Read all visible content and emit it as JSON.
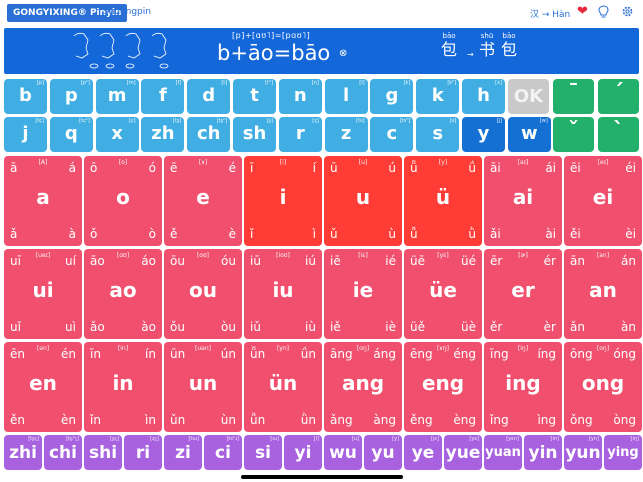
{
  "app": {
    "title": "GONGYIXING® Pinyin",
    "mode": "Shuangpin",
    "lang": "汉 → Hàn"
  },
  "banner": {
    "ipa": "[p]+[ɑʊ˥]=[pɑʊ˥]",
    "formula": "b+āo=bāo",
    "ex1": {
      "py": "bāo",
      "hz": "包"
    },
    "ex2": {
      "py": "shū",
      "hz": "书"
    },
    "ex3": {
      "py": "bāo",
      "hz": "包"
    },
    "arrow": "→"
  },
  "row1": [
    {
      "t": "b",
      "ip": "[p]"
    },
    {
      "t": "p",
      "ip": "[pʰ]"
    },
    {
      "t": "m",
      "ip": "[m]"
    },
    {
      "t": "f",
      "ip": "[f]"
    },
    {
      "t": "d",
      "ip": "[t]"
    },
    {
      "t": "t",
      "ip": "[tʰ]"
    },
    {
      "t": "n",
      "ip": "[n]"
    },
    {
      "t": "l",
      "ip": "[l]"
    },
    {
      "t": "g",
      "ip": "[k]"
    },
    {
      "t": "k",
      "ip": "[kʰ]"
    },
    {
      "t": "h",
      "ip": "[x]"
    }
  ],
  "row1_ok": "OK",
  "row2": [
    {
      "t": "j",
      "ip": "[tɕ]"
    },
    {
      "t": "q",
      "ip": "[tɕʰ]"
    },
    {
      "t": "x",
      "ip": "[ɕ]"
    },
    {
      "t": "zh",
      "ip": "[tʂ]"
    },
    {
      "t": "ch",
      "ip": "[tʂʰ]"
    },
    {
      "t": "sh",
      "ip": "[ʂ]"
    },
    {
      "t": "r",
      "ip": "[ʐ]"
    },
    {
      "t": "z",
      "ip": "[ts]"
    },
    {
      "t": "c",
      "ip": "[tsʰ]"
    },
    {
      "t": "s",
      "ip": "[s]"
    },
    {
      "t": "y",
      "ip": "[j]"
    },
    {
      "t": "w",
      "ip": "[w]"
    }
  ],
  "tones": [
    "¯",
    "´",
    "ˇ",
    "`"
  ],
  "vowels": [
    [
      {
        "m": "a",
        "c": [
          "ā",
          "á",
          "ǎ",
          "à"
        ],
        "ip": "[A]"
      },
      {
        "m": "o",
        "c": [
          "ō",
          "ó",
          "ǒ",
          "ò"
        ],
        "ip": "[o]"
      },
      {
        "m": "e",
        "c": [
          "ē",
          "é",
          "ě",
          "è"
        ],
        "ip": "[ɤ]"
      },
      {
        "m": "i",
        "c": [
          "ī",
          "í",
          "ǐ",
          "ì"
        ],
        "ip": "[i]"
      },
      {
        "m": "u",
        "c": [
          "ū",
          "ú",
          "ǔ",
          "ù"
        ],
        "ip": "[u]"
      },
      {
        "m": "ü",
        "c": [
          "ǖ",
          "ǘ",
          "ǚ",
          "ǜ"
        ],
        "ip": "[y]"
      },
      {
        "m": "ai",
        "c": [
          "āi",
          "ái",
          "ǎi",
          "ài"
        ],
        "ip": "[aɪ]"
      },
      {
        "m": "ei",
        "c": [
          "ēi",
          "éi",
          "ěi",
          "èi"
        ],
        "ip": "[eɪ]"
      }
    ],
    [
      {
        "m": "ui",
        "c": [
          "uī",
          "uí",
          "uǐ",
          "uì"
        ],
        "ip": "[ueɪ]"
      },
      {
        "m": "ao",
        "c": [
          "āo",
          "áo",
          "ǎo",
          "ào"
        ],
        "ip": "[ɑʊ]"
      },
      {
        "m": "ou",
        "c": [
          "ōu",
          "óu",
          "ǒu",
          "òu"
        ],
        "ip": "[oʊ]"
      },
      {
        "m": "iu",
        "c": [
          "iū",
          "iú",
          "iǔ",
          "iù"
        ],
        "ip": "[ioʊ]"
      },
      {
        "m": "ie",
        "c": [
          "iē",
          "ié",
          "iě",
          "iè"
        ],
        "ip": "[iɛ]"
      },
      {
        "m": "üe",
        "c": [
          "üē",
          "üé",
          "üě",
          "üè"
        ],
        "ip": "[yɛ]"
      },
      {
        "m": "er",
        "c": [
          "ēr",
          "ér",
          "ěr",
          "èr"
        ],
        "ip": "[ɚ]"
      },
      {
        "m": "an",
        "c": [
          "ān",
          "án",
          "ǎn",
          "àn"
        ],
        "ip": "[an]"
      }
    ],
    [
      {
        "m": "en",
        "c": [
          "ēn",
          "én",
          "ěn",
          "èn"
        ],
        "ip": "[ən]"
      },
      {
        "m": "in",
        "c": [
          "īn",
          "ín",
          "ǐn",
          "ìn"
        ],
        "ip": "[in]"
      },
      {
        "m": "un",
        "c": [
          "ūn",
          "ún",
          "ǔn",
          "ùn"
        ],
        "ip": "[uən]"
      },
      {
        "m": "ün",
        "c": [
          "ǖn",
          "ǘn",
          "ǚn",
          "ǜn"
        ],
        "ip": "[yn]"
      },
      {
        "m": "ang",
        "c": [
          "āng",
          "áng",
          "ǎng",
          "àng"
        ],
        "ip": "[ɑŋ]"
      },
      {
        "m": "eng",
        "c": [
          "ēng",
          "éng",
          "ěng",
          "èng"
        ],
        "ip": "[ɤŋ]"
      },
      {
        "m": "ing",
        "c": [
          "īng",
          "íng",
          "ǐng",
          "ìng"
        ],
        "ip": "[iŋ]"
      },
      {
        "m": "ong",
        "c": [
          "ōng",
          "óng",
          "ǒng",
          "òng"
        ],
        "ip": "[oŋ]"
      }
    ]
  ],
  "syllables": [
    {
      "t": "zhi",
      "ip": "[tʂʅ]"
    },
    {
      "t": "chi",
      "ip": "[tʂʰʅ]"
    },
    {
      "t": "shi",
      "ip": "[ʂʅ]"
    },
    {
      "t": "ri",
      "ip": "[ʐʅ]"
    },
    {
      "t": "zi",
      "ip": "[tsɹ]"
    },
    {
      "t": "ci",
      "ip": "[tsʰɹ]"
    },
    {
      "t": "si",
      "ip": "[sɹ]"
    },
    {
      "t": "yi",
      "ip": "[i]"
    },
    {
      "t": "wu",
      "ip": "[u]"
    },
    {
      "t": "yu",
      "ip": "[y]"
    },
    {
      "t": "ye",
      "ip": "[jɛ]"
    },
    {
      "t": "yue",
      "ip": "[yɛ]"
    },
    {
      "t": "yuan",
      "ip": "[yɛn]"
    },
    {
      "t": "yin",
      "ip": "[in]"
    },
    {
      "t": "yun",
      "ip": "[yn]"
    },
    {
      "t": "ying",
      "ip": "[iŋ]"
    }
  ],
  "colors": {
    "blue": "#41aee3",
    "green": "#22b06a",
    "pink": "#f0506e",
    "red": "#ff3d36",
    "purple": "#a862e0",
    "banner": "#1467d9"
  }
}
